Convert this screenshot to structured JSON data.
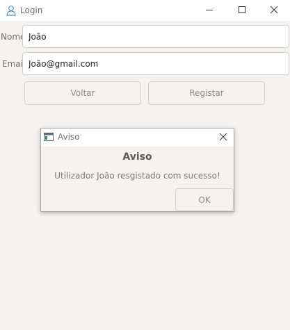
{
  "window": {
    "title": "Login",
    "icons": {
      "app": "user-icon",
      "minimize": "minimize-icon",
      "maximize": "maximize-icon",
      "close": "close-icon"
    }
  },
  "form": {
    "nome_label": "Nome",
    "nome_value": "João",
    "email_label": "Email",
    "email_value": "João@gmail.com",
    "voltar_label": "Voltar",
    "registar_label": "Registar"
  },
  "dialog": {
    "title": "Aviso",
    "heading": "Aviso",
    "message": "Utilizador João resgistado com sucesso!",
    "ok_label": "OK",
    "icons": {
      "window": "window-icon",
      "close": "close-icon"
    }
  },
  "colors": {
    "background": "#f4f3f1",
    "titlebar": "#ffffff",
    "border": "#cfcfcf"
  }
}
